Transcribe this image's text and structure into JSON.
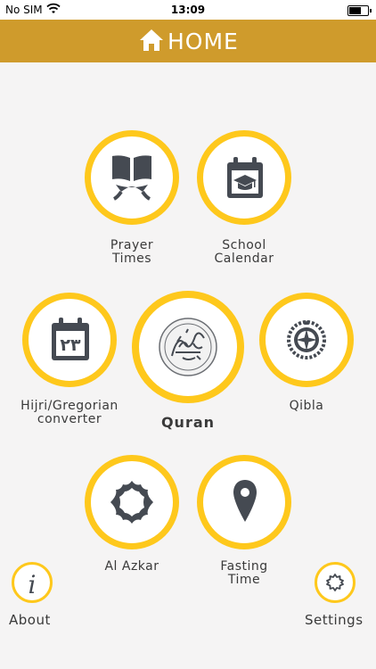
{
  "status": {
    "carrier": "No SIM",
    "time": "13:09"
  },
  "header": {
    "title": "HOME",
    "icon": "home-icon"
  },
  "tiles": {
    "prayer": {
      "label": "Prayer\nTimes",
      "icon": "book-stand-icon"
    },
    "school": {
      "label": "School\nCalendar",
      "icon": "graduation-calendar-icon"
    },
    "hijri": {
      "label": "Hijri/Gregorian\nconverter",
      "icon": "calendar-icon",
      "icon_text": "٢٣"
    },
    "quran": {
      "label": "Quran",
      "icon": "quran-calligraphy-icon"
    },
    "qibla": {
      "label": "Qibla",
      "icon": "compass-icon"
    },
    "azkar": {
      "label": "Al Azkar",
      "icon": "ornament-frame-icon"
    },
    "fasting": {
      "label": "Fasting\nTime",
      "icon": "location-pin-icon"
    }
  },
  "footer": {
    "about": {
      "label": "About",
      "icon": "info-icon",
      "icon_text": "i"
    },
    "settings": {
      "label": "Settings",
      "icon": "gear-icon"
    }
  },
  "colors": {
    "header": "#cf9b2c",
    "ring": "#fec81c",
    "icon": "#454a52",
    "background": "#f5f4f4"
  }
}
